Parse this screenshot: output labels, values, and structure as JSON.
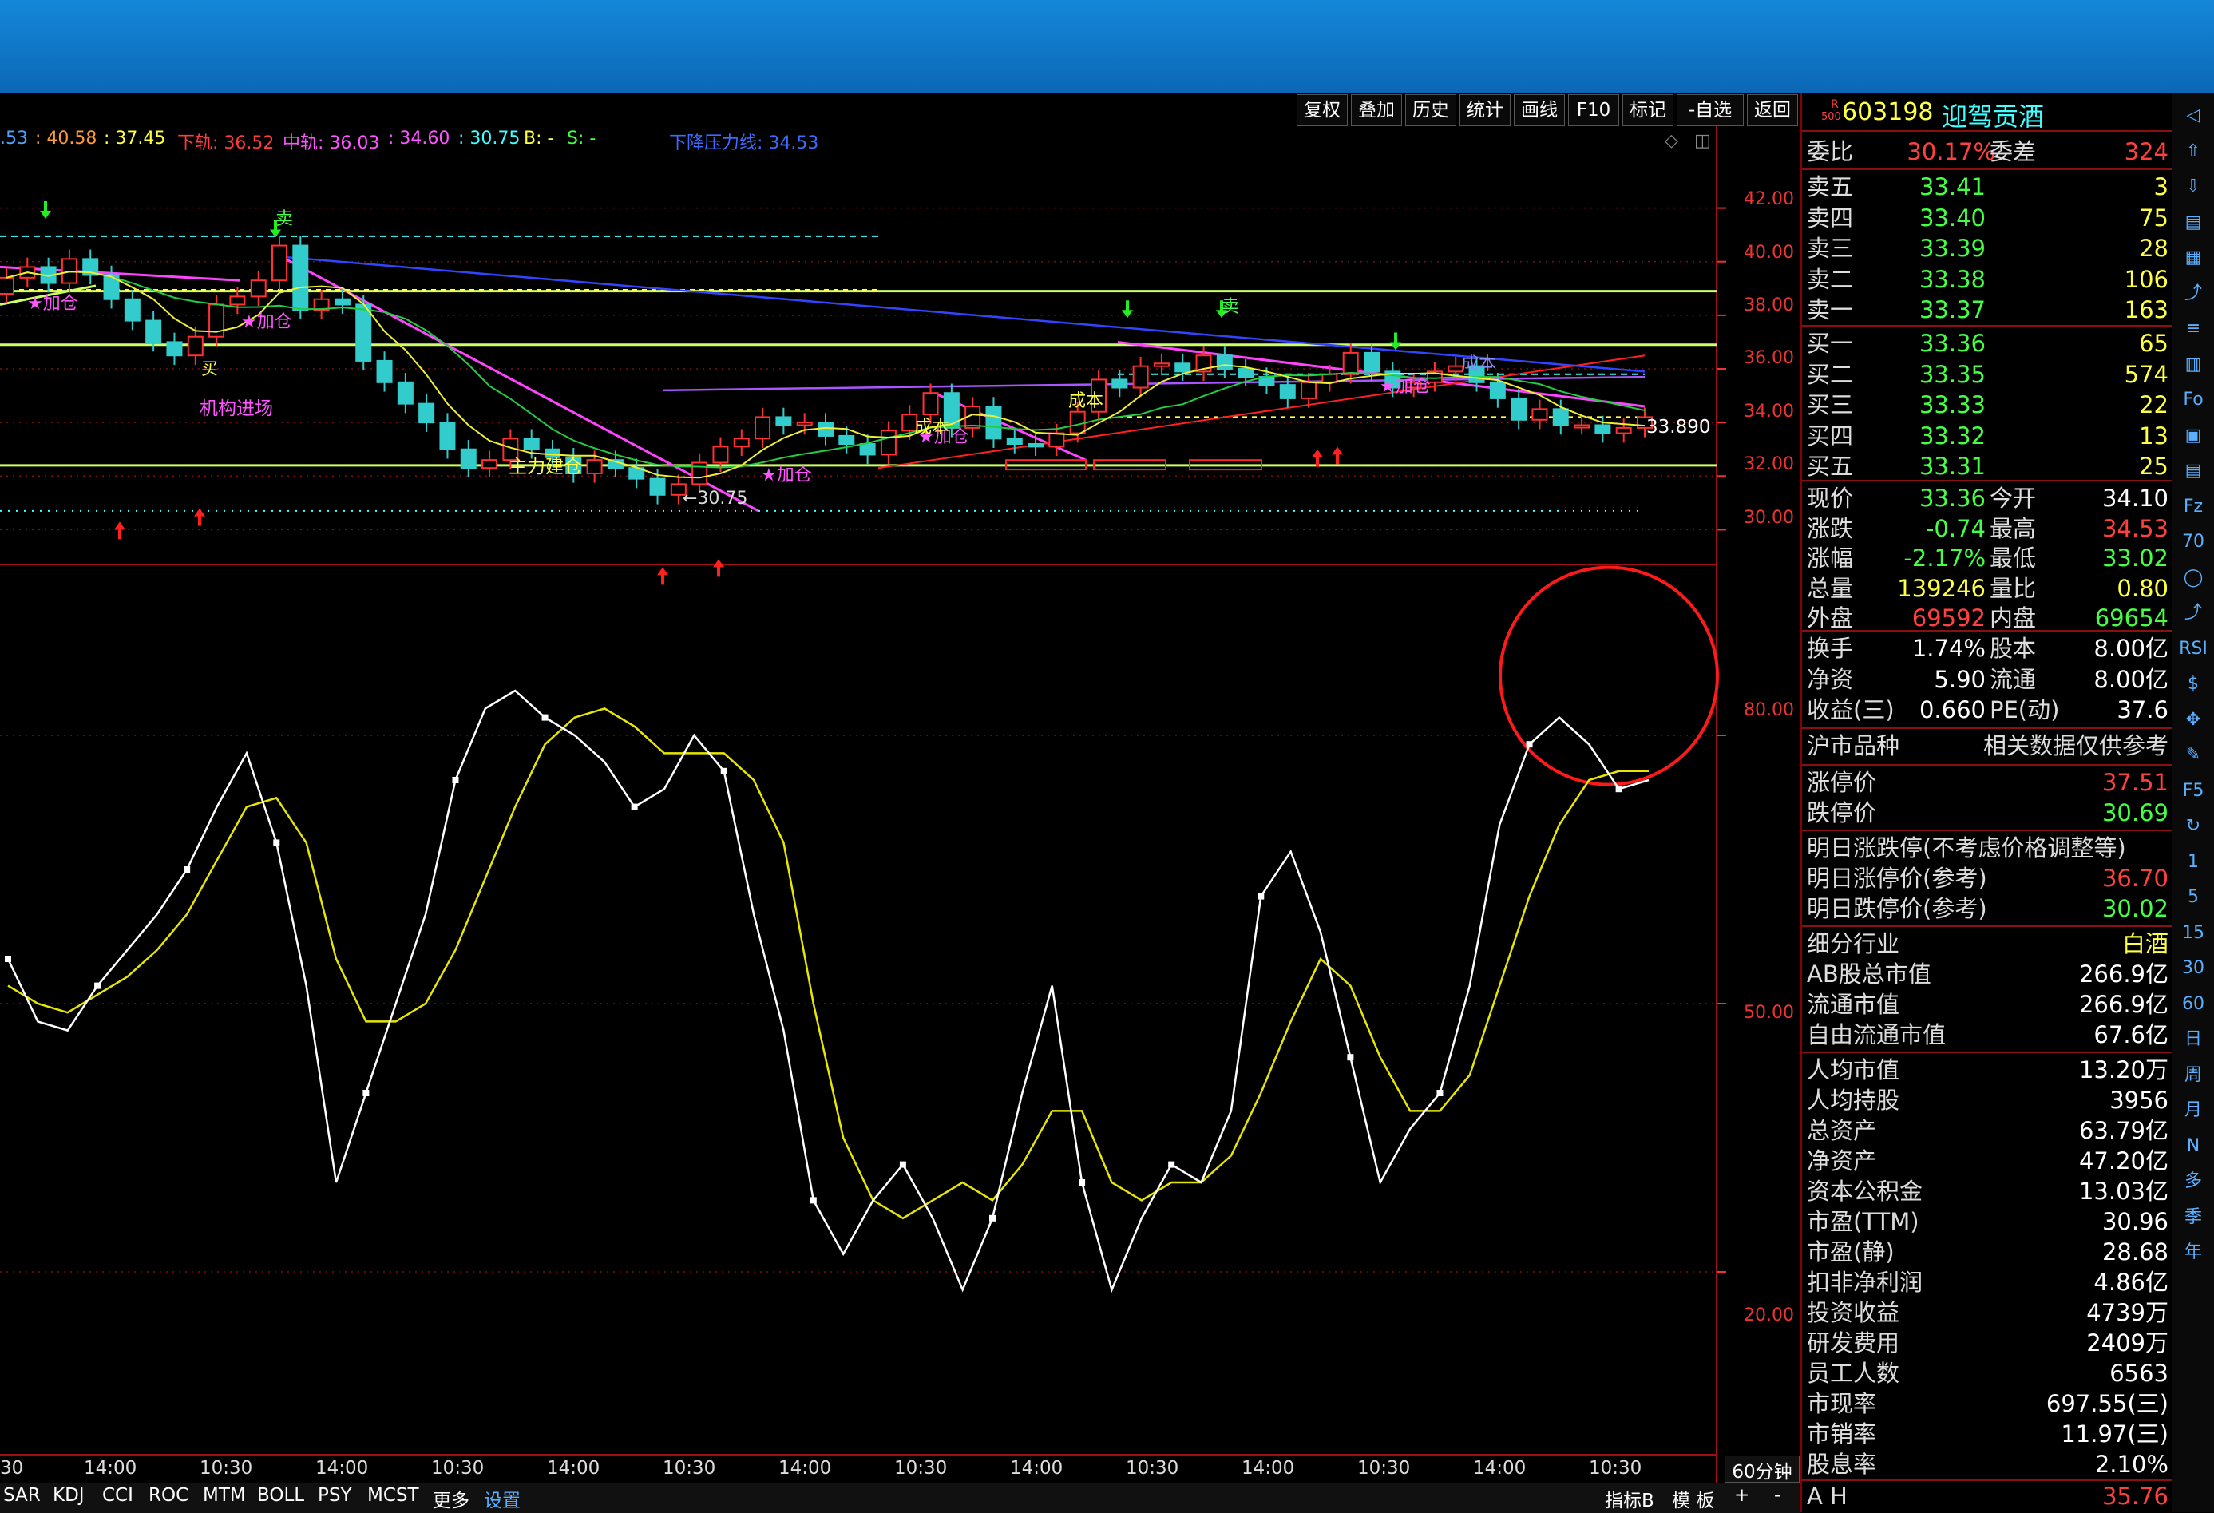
{
  "toolbar": [
    "复权",
    "叠加",
    "历史",
    "统计",
    "画线",
    "F10",
    "标记",
    "-自选",
    "返回"
  ],
  "legend": {
    "items": [
      {
        "text": ".53",
        "color": "#4aa3ff"
      },
      {
        "text": ": 40.58",
        "color": "#ff9a3a"
      },
      {
        "text": ": 37.45",
        "color": "#ffff44"
      },
      {
        "text": "下轨: 36.52",
        "color": "#ff3b3b"
      },
      {
        "text": "中轨: 36.03",
        "color": "#ff55ff"
      },
      {
        "text": ": 34.60",
        "color": "#ff55ff"
      },
      {
        "text": ": 30.75",
        "color": "#44ffff"
      },
      {
        "text": "B: -",
        "color": "#ffff44"
      },
      {
        "text": "S: -",
        "color": "#44ff44"
      },
      {
        "text": "下降压力线: 34.53",
        "color": "#3b6bff"
      }
    ]
  },
  "price_axis": [
    "42.00",
    "40.00",
    "38.00",
    "36.00",
    "34.00",
    "32.00",
    "30.00"
  ],
  "indicator_axis": [
    "80.00",
    "50.00",
    "20.00"
  ],
  "last_price_label": "33.890",
  "low_label": "←30.75",
  "chart_labels": {
    "add1": "★加仓",
    "add2": "★加仓",
    "add3": "★加仓",
    "add4": "★加仓",
    "add5": "★加仓",
    "inst": "机构进场",
    "main": "主力建仓",
    "buy": "买",
    "sell1": "卖",
    "sell2": "卖",
    "chengben1": "成本",
    "chengben2": "成本",
    "chengben3": "成本"
  },
  "time_axis": [
    "30",
    "14:00",
    "10:30",
    "14:00",
    "10:30",
    "14:00",
    "10:30",
    "14:00",
    "10:30",
    "14:00",
    "10:30",
    "14:00",
    "10:30",
    "14:00",
    "10:30"
  ],
  "period_label": "60分钟",
  "indicator_tabs": [
    "SAR",
    "KDJ",
    "CCI",
    "ROC",
    "MTM",
    "BOLL",
    "PSY",
    "MCST",
    "更多",
    "设置"
  ],
  "bottom_right": [
    "指标B",
    "模 板",
    "+",
    "-"
  ],
  "panel": {
    "code": "603198",
    "name": "迎驾贡酒",
    "badge_top": "R",
    "badge_bottom": "500",
    "weibi": {
      "label": "委比",
      "value": "30.17%",
      "label2": "委差",
      "value2": "324"
    },
    "sells": [
      {
        "label": "卖五",
        "price": "33.41",
        "vol": "3"
      },
      {
        "label": "卖四",
        "price": "33.40",
        "vol": "75"
      },
      {
        "label": "卖三",
        "price": "33.39",
        "vol": "28"
      },
      {
        "label": "卖二",
        "price": "33.38",
        "vol": "106"
      },
      {
        "label": "卖一",
        "price": "33.37",
        "vol": "163"
      }
    ],
    "buys": [
      {
        "label": "买一",
        "price": "33.36",
        "vol": "65"
      },
      {
        "label": "买二",
        "price": "33.35",
        "vol": "574"
      },
      {
        "label": "买三",
        "price": "33.33",
        "vol": "22"
      },
      {
        "label": "买四",
        "price": "33.32",
        "vol": "13"
      },
      {
        "label": "买五",
        "price": "33.31",
        "vol": "25"
      }
    ],
    "quote": [
      {
        "l": "现价",
        "v": "33.36",
        "l2": "今开",
        "v2": "34.10",
        "c": "#44ff44",
        "c2": "#ffffff"
      },
      {
        "l": "涨跌",
        "v": "-0.74",
        "l2": "最高",
        "v2": "34.53",
        "c": "#44ff44",
        "c2": "#ff4040"
      },
      {
        "l": "涨幅",
        "v": "-2.17%",
        "l2": "最低",
        "v2": "33.02",
        "c": "#44ff44",
        "c2": "#44ff44"
      },
      {
        "l": "总量",
        "v": "139246",
        "l2": "量比",
        "v2": "0.80",
        "c": "#ffff44",
        "c2": "#ffff44"
      },
      {
        "l": "外盘",
        "v": "69592",
        "l2": "内盘",
        "v2": "69654",
        "c": "#ff4040",
        "c2": "#44ff44"
      }
    ],
    "fund": [
      {
        "l": "换手",
        "v": "1.74%",
        "l2": "股本",
        "v2": "8.00亿"
      },
      {
        "l": "净资",
        "v": "5.90",
        "l2": "流通",
        "v2": "8.00亿"
      },
      {
        "l": "收益(三)",
        "v": "0.660",
        "l2": "PE(动)",
        "v2": "37.6"
      }
    ],
    "market": {
      "l": "沪市品种",
      "r": "相关数据仅供参考"
    },
    "limits": [
      {
        "l": "涨停价",
        "v": "37.51",
        "c": "#ff4040"
      },
      {
        "l": "跌停价",
        "v": "30.69",
        "c": "#44ff44"
      }
    ],
    "tomorrow": {
      "title": "明日涨跌停(不考虑价格调整等)",
      "up_l": "明日涨停价(参考)",
      "up_v": "36.70",
      "down_l": "明日跌停价(参考)",
      "down_v": "30.02"
    },
    "industry": {
      "l": "细分行业",
      "v": "白酒"
    },
    "values": [
      {
        "l": "AB股总市值",
        "v": "266.9亿"
      },
      {
        "l": "流通市值",
        "v": "266.9亿"
      },
      {
        "l": "自由流通市值",
        "v": "67.6亿"
      }
    ],
    "stats": [
      {
        "l": "人均市值",
        "v": "13.20万"
      },
      {
        "l": "人均持股",
        "v": "3956"
      },
      {
        "l": "总资产",
        "v": "63.79亿"
      },
      {
        "l": "净资产",
        "v": "47.20亿"
      },
      {
        "l": "资本公积金",
        "v": "13.03亿"
      },
      {
        "l": "市盈(TTM)",
        "v": "30.96"
      },
      {
        "l": "市盈(静)",
        "v": "28.68"
      },
      {
        "l": "扣非净利润",
        "v": "4.86亿"
      },
      {
        "l": "投资收益",
        "v": "4739万"
      },
      {
        "l": "研发费用",
        "v": "2409万"
      },
      {
        "l": "员工人数",
        "v": "6563"
      },
      {
        "l": "市现率",
        "v": "697.55(三)"
      },
      {
        "l": "市销率",
        "v": "11.97(三)"
      },
      {
        "l": "股息率",
        "v": "2.10%"
      }
    ],
    "ah": {
      "l": "A H",
      "v": "35.76"
    }
  },
  "side_icons": [
    "◁",
    "⇧",
    "⇩",
    "▤",
    "▦",
    "⤴",
    "≡",
    "▥",
    "Fo",
    "▣",
    "▤",
    "Fz",
    "70",
    "◯",
    "⤴",
    "RSI",
    "$",
    "✥",
    "✎",
    "F5",
    "↻",
    "1",
    "5",
    "15",
    "30",
    "60",
    "日",
    "周",
    "月",
    "N",
    "多",
    "季",
    "年"
  ],
  "chart_data": {
    "type": "line",
    "price_ylim": [
      29,
      43
    ],
    "indicator_ylim": [
      0,
      100
    ],
    "k": [
      55,
      48,
      47,
      52,
      56,
      60,
      65,
      72,
      78,
      68,
      52,
      30,
      40,
      50,
      60,
      75,
      83,
      85,
      82,
      80,
      77,
      72,
      74,
      80,
      76,
      60,
      47,
      28,
      22,
      28,
      32,
      26,
      18,
      26,
      40,
      52,
      30,
      18,
      26,
      32,
      30,
      38,
      62,
      67,
      58,
      44,
      30,
      36,
      40,
      52,
      70,
      79,
      82,
      79,
      74,
      75
    ],
    "d": [
      52,
      50,
      49,
      51,
      53,
      56,
      60,
      66,
      72,
      73,
      68,
      55,
      48,
      48,
      50,
      56,
      64,
      72,
      79,
      82,
      83,
      81,
      78,
      78,
      78,
      75,
      68,
      50,
      35,
      28,
      26,
      28,
      30,
      28,
      32,
      38,
      38,
      30,
      28,
      30,
      30,
      33,
      40,
      48,
      55,
      52,
      44,
      38,
      38,
      42,
      52,
      62,
      70,
      75,
      76,
      76
    ]
  }
}
